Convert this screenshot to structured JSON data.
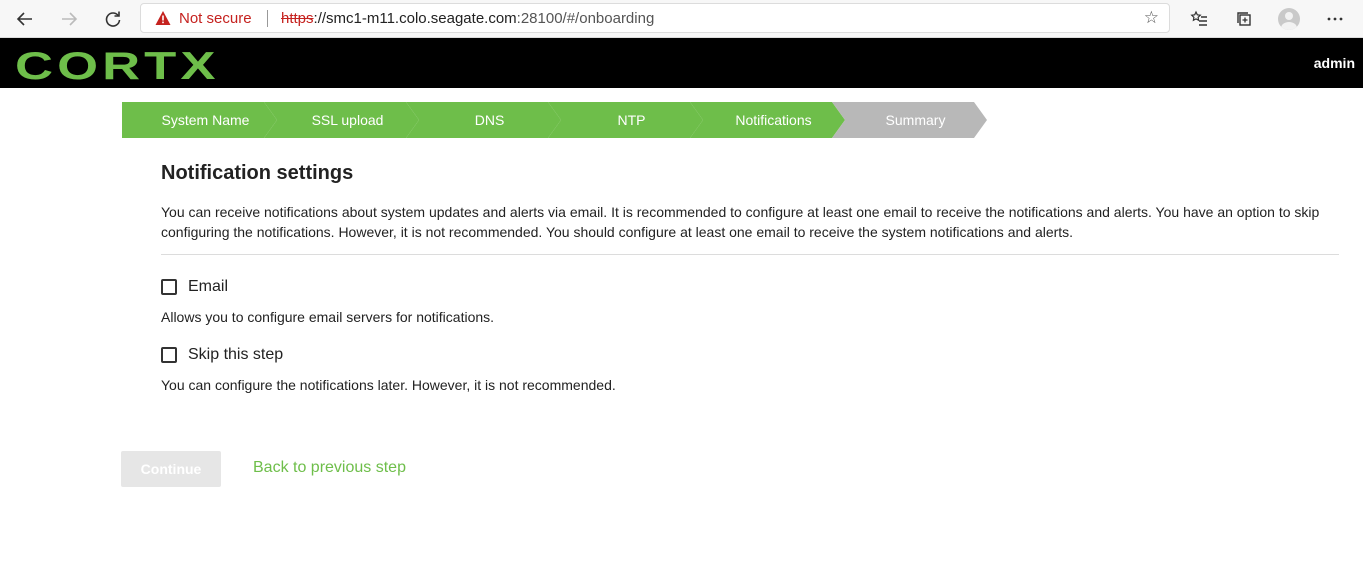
{
  "browser": {
    "security_text": "Not secure",
    "url_scheme": "https",
    "url_host": "://smc1-m11.colo.seagate.com",
    "url_path": ":28100/#/onboarding"
  },
  "header": {
    "logo": "CORTX",
    "user": "admin"
  },
  "stepper": {
    "steps": [
      {
        "label": "System Name",
        "state": "done"
      },
      {
        "label": "SSL upload",
        "state": "done"
      },
      {
        "label": "DNS",
        "state": "done"
      },
      {
        "label": "NTP",
        "state": "done"
      },
      {
        "label": "Notifications",
        "state": "done"
      },
      {
        "label": "Summary",
        "state": "todo"
      }
    ]
  },
  "content": {
    "title": "Notification settings",
    "description": "You can receive notifications about system updates and alerts via email. It is recommended to configure at least one email to receive the notifications and alerts. You have an option to skip configuring the notifications. However, it is not recommended. You should configure at least one email to receive the system notifications and alerts.",
    "options": [
      {
        "label": "Email",
        "hint": "Allows you to configure email servers for notifications.",
        "checked": false
      },
      {
        "label": "Skip this step",
        "hint": "You can configure the notifications later. However, it is not recommended.",
        "checked": false
      }
    ]
  },
  "actions": {
    "continue_label": "Continue",
    "back_label": "Back to previous step"
  },
  "colors": {
    "accent": "#6ebe4a",
    "inactive_step": "#b8b8b8",
    "header_bg": "#000000",
    "warning": "#c5221f"
  },
  "icons": [
    "back-arrow-icon",
    "forward-arrow-icon",
    "refresh-icon",
    "warning-icon",
    "star-icon",
    "favorites-icon",
    "collections-icon",
    "profile-icon",
    "more-icon"
  ]
}
